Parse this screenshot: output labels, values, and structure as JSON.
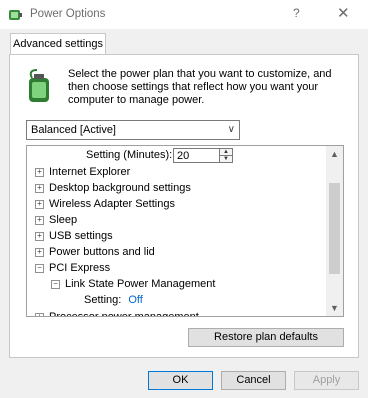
{
  "window": {
    "title": "Power Options",
    "help_label": "?",
    "close_label": "✕"
  },
  "tabs": [
    {
      "label": "Advanced settings"
    }
  ],
  "intro": {
    "text": "Select the power plan that you want to customize, and then choose settings that reflect how you want your computer to manage power."
  },
  "plan_select": {
    "value": "Balanced [Active]"
  },
  "tree": {
    "rows": [
      {
        "label": "Setting (Minutes):",
        "value": "20",
        "type": "spinner"
      },
      {
        "label": "Internet Explorer",
        "expander": "+"
      },
      {
        "label": "Desktop background settings",
        "expander": "+"
      },
      {
        "label": "Wireless Adapter Settings",
        "expander": "+"
      },
      {
        "label": "Sleep",
        "expander": "+"
      },
      {
        "label": "USB settings",
        "expander": "+"
      },
      {
        "label": "Power buttons and lid",
        "expander": "+"
      },
      {
        "label": "PCI Express",
        "expander": "−"
      },
      {
        "label": "Link State Power Management",
        "expander": "−"
      },
      {
        "label": "Setting:",
        "value": "Off",
        "type": "link"
      },
      {
        "label": "Processor power management",
        "expander": "+"
      }
    ]
  },
  "buttons": {
    "restore": "Restore plan defaults",
    "ok": "OK",
    "cancel": "Cancel",
    "apply": "Apply"
  },
  "colors": {
    "link": "#0066cc",
    "accent": "#0078d7"
  }
}
